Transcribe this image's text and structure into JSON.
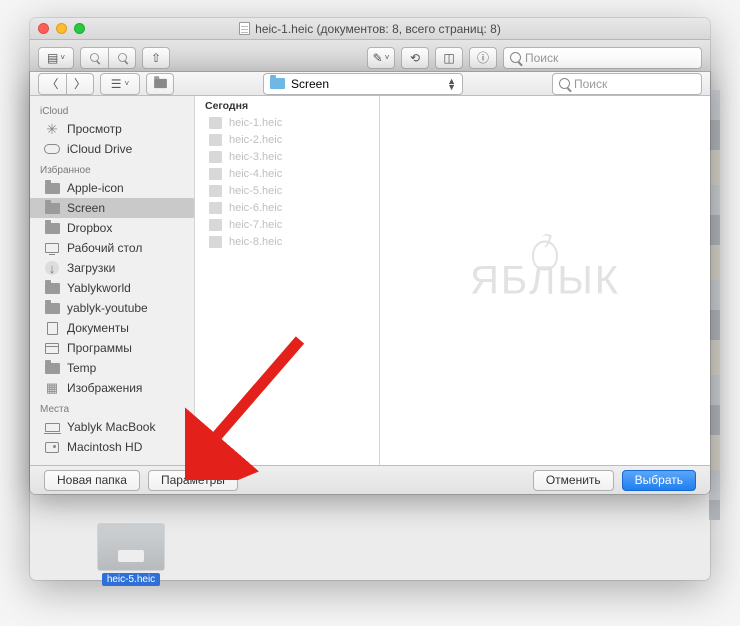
{
  "window": {
    "title": "heic-1.heic (документов: 8, всего страниц: 8)",
    "toolbar_search_placeholder": "Поиск"
  },
  "sheet": {
    "path_folder": "Screen",
    "search_placeholder": "Поиск"
  },
  "sidebar": {
    "sections": [
      {
        "header": "iCloud",
        "items": [
          {
            "icon": "star",
            "label": "Просмотр"
          },
          {
            "icon": "cloud",
            "label": "iCloud Drive"
          }
        ]
      },
      {
        "header": "Избранное",
        "items": [
          {
            "icon": "folder",
            "label": "Apple-icon"
          },
          {
            "icon": "folder",
            "label": "Screen",
            "selected": true
          },
          {
            "icon": "folder",
            "label": "Dropbox"
          },
          {
            "icon": "desk",
            "label": "Рабочий стол"
          },
          {
            "icon": "down",
            "label": "Загрузки"
          },
          {
            "icon": "folder",
            "label": "Yablykworld"
          },
          {
            "icon": "folder",
            "label": "yablyk-youtube"
          },
          {
            "icon": "doc",
            "label": "Документы"
          },
          {
            "icon": "wind",
            "label": "Программы"
          },
          {
            "icon": "folder",
            "label": "Temp"
          },
          {
            "icon": "img",
            "label": "Изображения"
          }
        ]
      },
      {
        "header": "Места",
        "items": [
          {
            "icon": "lap",
            "label": "Yablyk MacBook"
          },
          {
            "icon": "disk",
            "label": "Macintosh HD"
          }
        ]
      }
    ]
  },
  "filelist": {
    "header": "Сегодня",
    "items": [
      "heic-1.heic",
      "heic-2.heic",
      "heic-3.heic",
      "heic-4.heic",
      "heic-5.heic",
      "heic-6.heic",
      "heic-7.heic",
      "heic-8.heic"
    ]
  },
  "footer": {
    "new_folder": "Новая папка",
    "options": "Параметры",
    "cancel": "Отменить",
    "choose": "Выбрать"
  },
  "thumbnail": {
    "label": "heic-5.heic"
  },
  "watermark": "ЯБЛЫК"
}
